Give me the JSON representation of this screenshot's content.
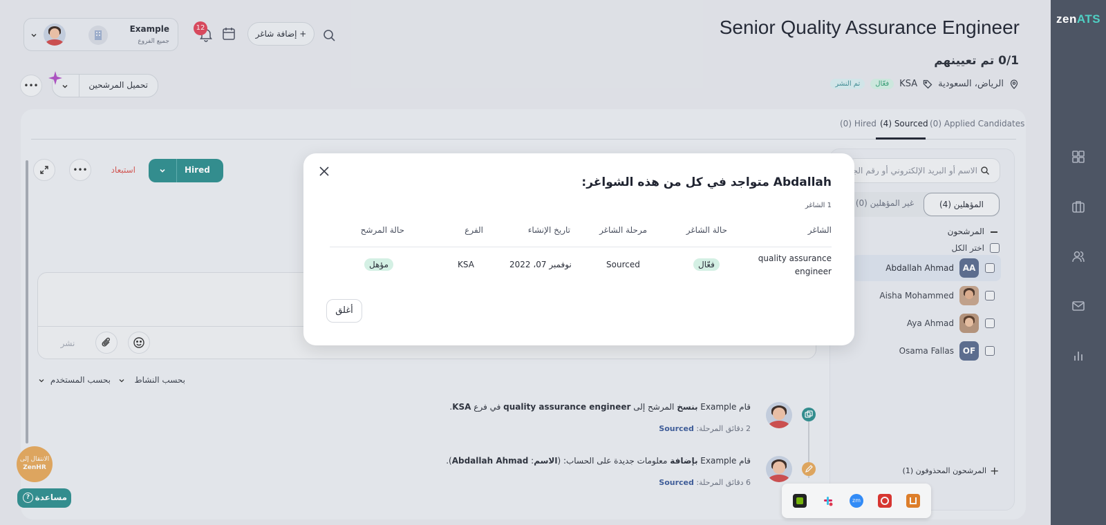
{
  "app": {
    "logo_prefix": "zen",
    "logo_suffix": "ATS"
  },
  "header": {
    "job_title": "Senior Quality Assurance Engineer",
    "assigned": "0/1 تم تعيينهم",
    "location": "الرياض، السعودية",
    "branch_tag": "KSA",
    "status_active": "فعّال",
    "status_published": "تم النشر",
    "profile_name": "Example",
    "profile_branch": "جميع الفروع",
    "notifications_count": "12",
    "add_job_label": "+ إضافة شاغر",
    "upload_candidates_label": "تحميل المرشحين"
  },
  "tabs": [
    {
      "label": "(0) Hired"
    },
    {
      "label": "(4) Sourced"
    },
    {
      "label": "(0) Applied Candidates"
    }
  ],
  "candidates_panel": {
    "search_placeholder": "الاسم أو البريد الإلكتروني أو رقم الجوال",
    "qualified_label": "المؤهلين (4)",
    "unqualified_label": "غير المؤهلين (0)",
    "section_label": "المرشحون",
    "select_all_label": "اختر الكل",
    "deleted_label": "المرشحون المحذوفون (1)",
    "items": [
      {
        "name": "Abdallah Ahmad",
        "initials": "AA"
      },
      {
        "name": "Aisha Mohammed",
        "initials": ""
      },
      {
        "name": "Aya Ahmad",
        "initials": ""
      },
      {
        "name": "Osama Fallas",
        "initials": "OF"
      }
    ]
  },
  "detail": {
    "stage_button": "Hired",
    "exclude_label": "استبعاد",
    "post_label": "نشر",
    "filter_activity": "بحسب النشاط",
    "filter_user": "بحسب المستخدم"
  },
  "activity": [
    {
      "prefix": "قام Example ",
      "action": "بنسخ",
      "mid": " المرشح إلى ",
      "target": "quality assurance engineer",
      "suffix": " في فرع ",
      "branch": "KSA",
      "end": ".",
      "time": "2 دقائق",
      "stage_label": "المرحلة: ",
      "stage": "Sourced"
    },
    {
      "prefix": "قام Example ",
      "action": "بإضافة",
      "mid": " معلومات جديدة على الحساب: (",
      "target": "الاسم",
      "suffix": ": ",
      "branch": "Abdallah Ahmad",
      "end": ").",
      "time": "6 دقائق",
      "stage_label": "المرحلة: ",
      "stage": "Sourced"
    }
  ],
  "widgets": {
    "zenhr_line1": "الانتقال إلى",
    "zenhr_line2": "ZenHR",
    "help_label": "مساعدة"
  },
  "modal": {
    "title_name": "Abdallah",
    "title_rest": " متواجد في كل من هذه الشواغر:",
    "count": "1 الشاغر",
    "columns": [
      "الشاغر",
      "حالة الشاغر",
      "مرحلة الشاغر",
      "تاريخ الإنشاء",
      "الفرع",
      "حالة المرشح"
    ],
    "row": {
      "job_line1": "quality assurance",
      "job_line2": "engineer",
      "job_status": "فعّال",
      "stage": "Sourced",
      "created": "نوفمبر 07، 2022",
      "branch": "KSA",
      "candidate_status": "مؤهل"
    },
    "close_label": "أغلق"
  },
  "colors": {
    "accent": "#2e8f8f",
    "rail": "#4d5564",
    "badge": "#e0455a"
  }
}
